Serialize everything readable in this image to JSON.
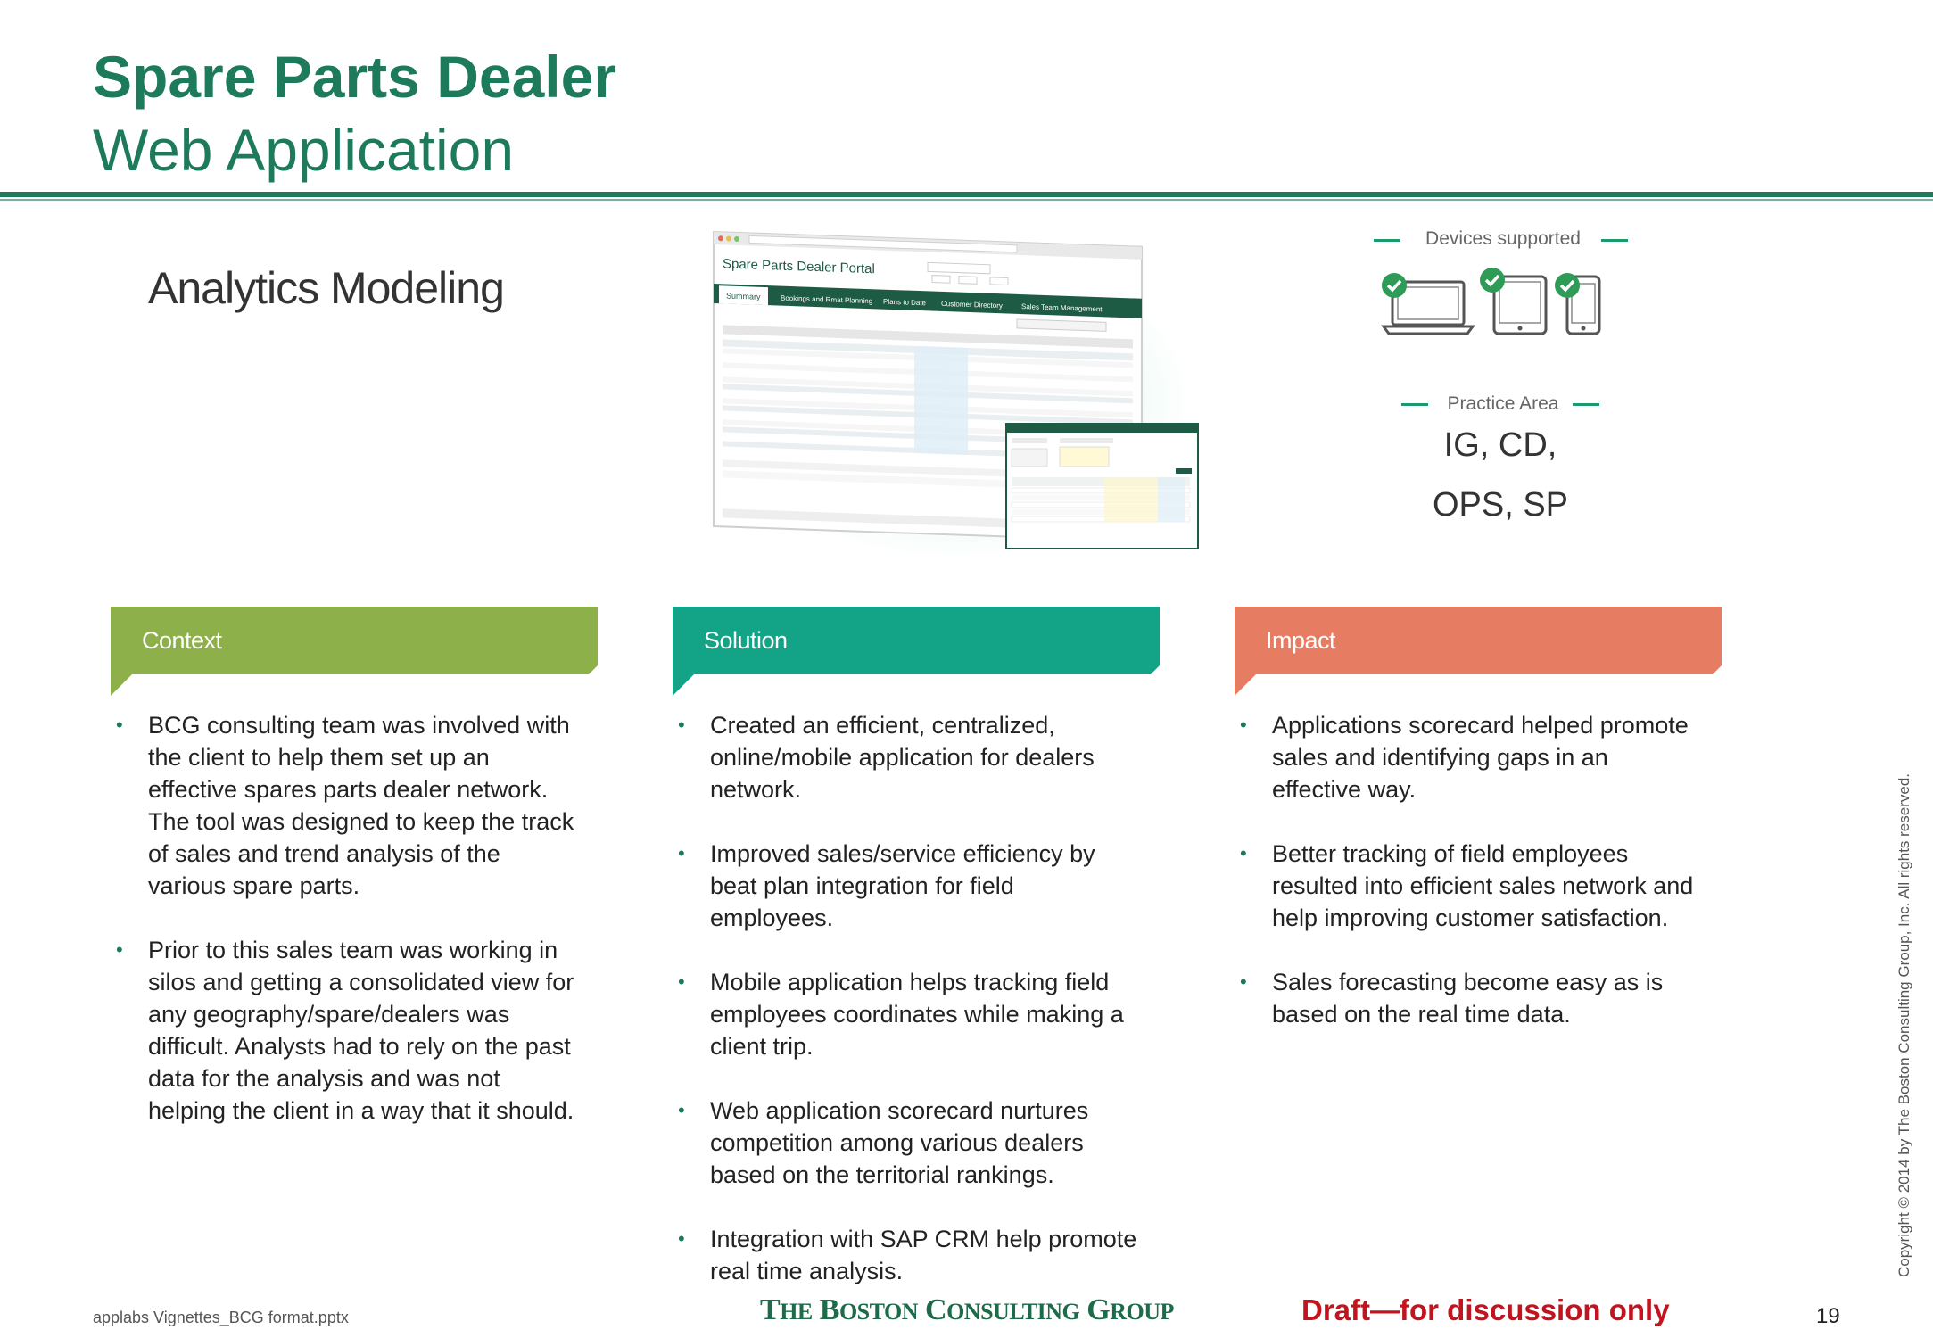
{
  "header": {
    "title_line1": "Spare Parts Dealer",
    "title_line2": "Web Application",
    "subtitle": "Analytics Modeling"
  },
  "screenshot": {
    "portal_title": "Spare Parts Dealer Portal",
    "tabs": [
      "Summary",
      "Bookings and Rmat Planning",
      "Plans to Date",
      "Customer Directory",
      "Sales Team Management"
    ]
  },
  "side_panel": {
    "devices_label": "Devices supported",
    "devices": [
      "laptop-icon",
      "tablet-icon",
      "phone-icon"
    ],
    "practice_label": "Practice Area",
    "practice_line1": "IG, CD,",
    "practice_line2": "OPS, SP"
  },
  "sections": [
    {
      "label": "Context",
      "color": "#8db04a",
      "bullets": [
        "BCG consulting team was involved with the client to help them set up an effective spares parts dealer network. The tool was designed to keep the track of sales and trend analysis of the various spare parts.",
        "Prior to this sales team was working in silos and getting a consolidated view for any geography/spare/dealers was difficult. Analysts had to rely on the past data for the analysis and was not helping the client in a way that it should."
      ]
    },
    {
      "label": "Solution",
      "color": "#13a487",
      "bullets": [
        "Created an efficient, centralized, online/mobile application for dealers network.",
        "Improved sales/service efficiency by beat plan integration for field employees.",
        "Mobile application helps tracking field employees coordinates while making a client trip.",
        "Web application scorecard nurtures competition among various dealers based on the territorial rankings.",
        "Integration with SAP CRM help promote real time analysis."
      ]
    },
    {
      "label": "Impact",
      "color": "#e67c62",
      "bullets": [
        "Applications scorecard helped promote sales and identifying gaps in an effective way.",
        "Better tracking of field employees resulted into efficient sales network and help improving customer satisfaction.",
        "Sales forecasting become easy as is based on the real time data."
      ]
    }
  ],
  "footer": {
    "filename": "applabs Vignettes_BCG format.pptx",
    "logo_the": "T",
    "logo_he": "HE",
    "logo_b": "B",
    "logo_oston": "OSTON",
    "logo_c": "C",
    "logo_onsulting": "ONSULTING",
    "logo_g": "G",
    "logo_roup": "ROUP",
    "draft": "Draft—for discussion only",
    "page": "19",
    "copyright": "Copyright © 2014 by The Boston Consulting Group, Inc. All rights reserved."
  }
}
